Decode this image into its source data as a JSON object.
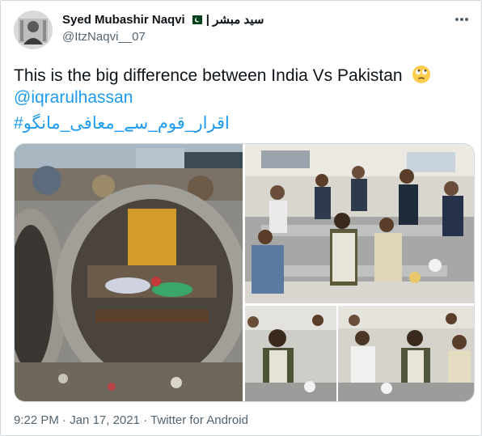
{
  "author": {
    "display_name": "Syed Mubashir Naqvi",
    "urdu_name": "سید مبشر |",
    "handle": "@ItzNaqvi__07"
  },
  "tweet": {
    "text": "This is the big difference between India Vs Pakistan",
    "emoji": "face-with-rolling-eyes-emoji",
    "mention": "@iqrarulhassan",
    "hashtag": "#اقرار_قوم_سے_معافی_مانگو"
  },
  "media": {
    "left_photo": "children-sleeping-in-concrete-pipe",
    "top_right_photo": "leader-eating-with-workers-in-canteen",
    "bottom_left_photo": "leader-seated-at-meal",
    "bottom_right_photo": "leader-dining-with-people"
  },
  "meta": {
    "time": "9:22 PM",
    "separator": "·",
    "date": "Jan 17, 2021",
    "app": "Twitter for Android"
  },
  "colors": {
    "accent": "#1d9bf0",
    "muted": "#536471",
    "text": "#0f1419"
  }
}
